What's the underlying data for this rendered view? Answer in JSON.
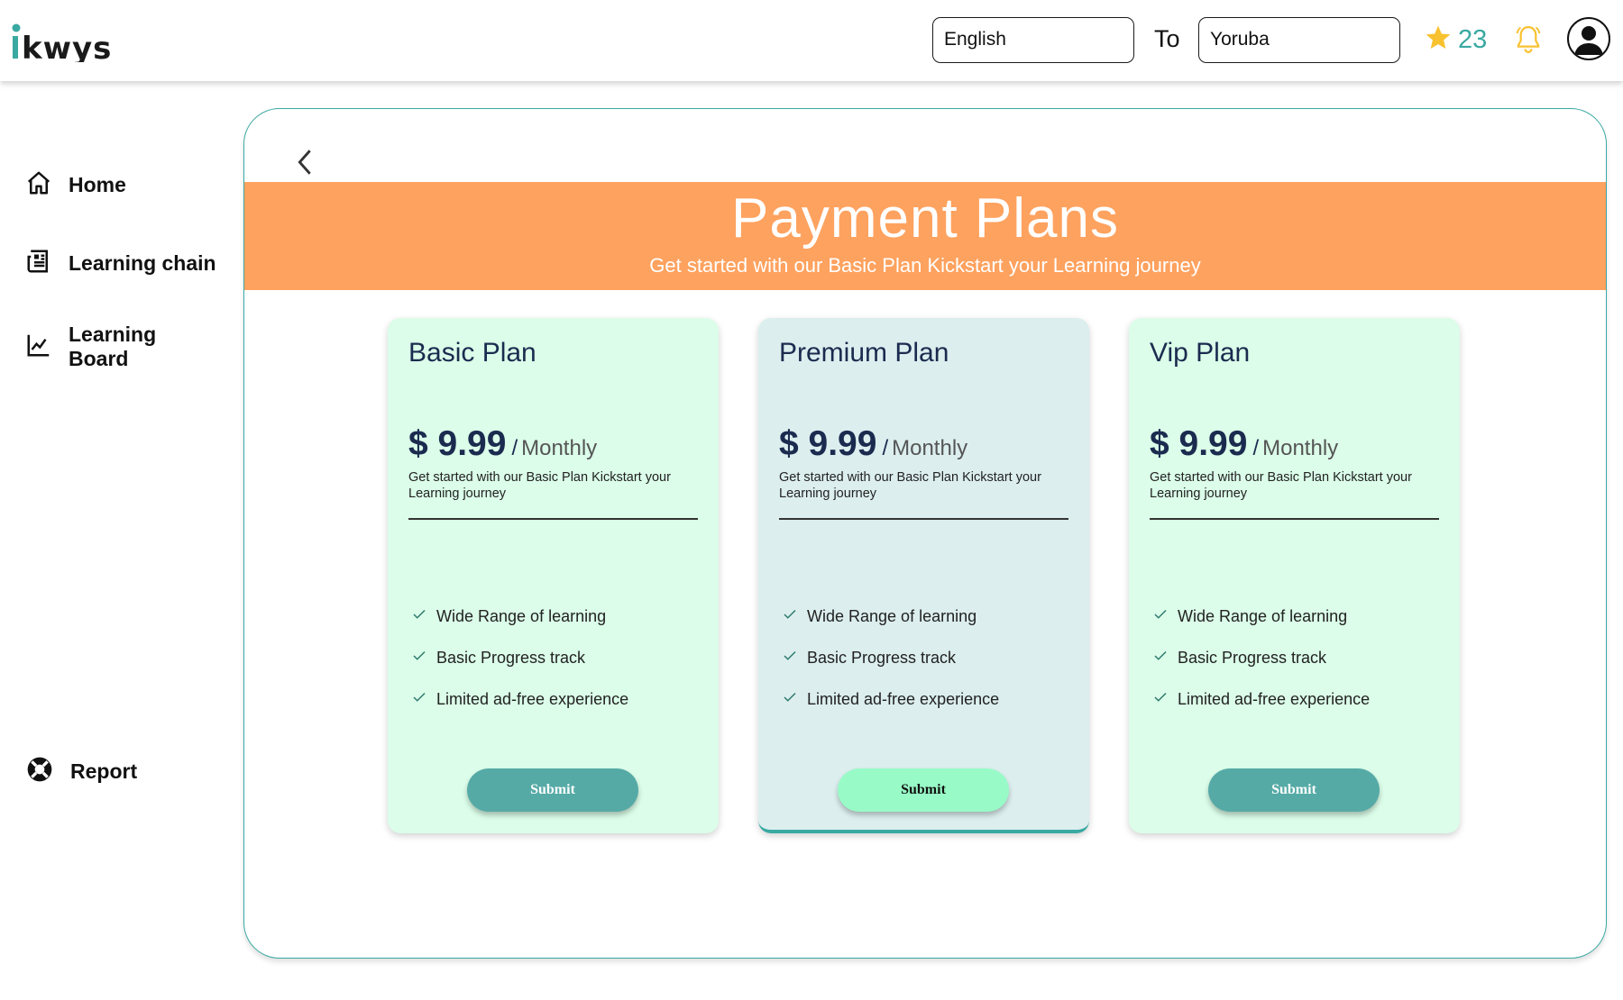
{
  "app": {
    "logo_text": "ikwys"
  },
  "header": {
    "from_language": "English",
    "to_label": "To",
    "to_language": "Yoruba",
    "star_count": "23",
    "icons": [
      "star-icon",
      "bell-icon",
      "user-avatar-icon"
    ]
  },
  "sidebar": {
    "items": [
      {
        "label": "Home",
        "icon": "home-icon"
      },
      {
        "label": "Learning chain",
        "icon": "newspaper-icon"
      },
      {
        "label": "Learning\nBoard",
        "icon": "chart-line-icon"
      },
      {
        "label": "Report",
        "icon": "lifebuoy-icon"
      }
    ]
  },
  "page": {
    "title": "Payment Plans",
    "subtitle": "Get started with our Basic Plan Kickstart your Learning journey"
  },
  "plans": [
    {
      "name": "Basic Plan",
      "price": "$ 9.99",
      "period": "Monthly",
      "description": "Get started with our Basic Plan Kickstart your Learning journey",
      "features": [
        "Wide Range of learning",
        "Basic Progress track",
        "Limited ad-free experience"
      ],
      "button": "Submit"
    },
    {
      "name": "Premium Plan",
      "price": "$ 9.99",
      "period": "Monthly",
      "description": "Get started with our Basic Plan Kickstart your Learning journey",
      "features": [
        "Wide Range of learning",
        "Basic Progress track",
        "Limited ad-free experience"
      ],
      "button": "Submit"
    },
    {
      "name": "Vip Plan",
      "price": "$ 9.99",
      "period": "Monthly",
      "description": "Get started with our Basic Plan Kickstart your Learning journey",
      "features": [
        "Wide Range of learning",
        "Basic Progress track",
        "Limited ad-free experience"
      ],
      "button": "Submit"
    }
  ],
  "colors": {
    "accent_teal": "#3aa9a2",
    "banner_orange": "#fea25f",
    "card_mint": "#dbfde9",
    "card_selected": "#dceeee",
    "button_dark": "#55aaa6",
    "button_light": "#98fbc7",
    "star_yellow": "#f8c12f",
    "heading_navy": "#1b2b4f"
  }
}
